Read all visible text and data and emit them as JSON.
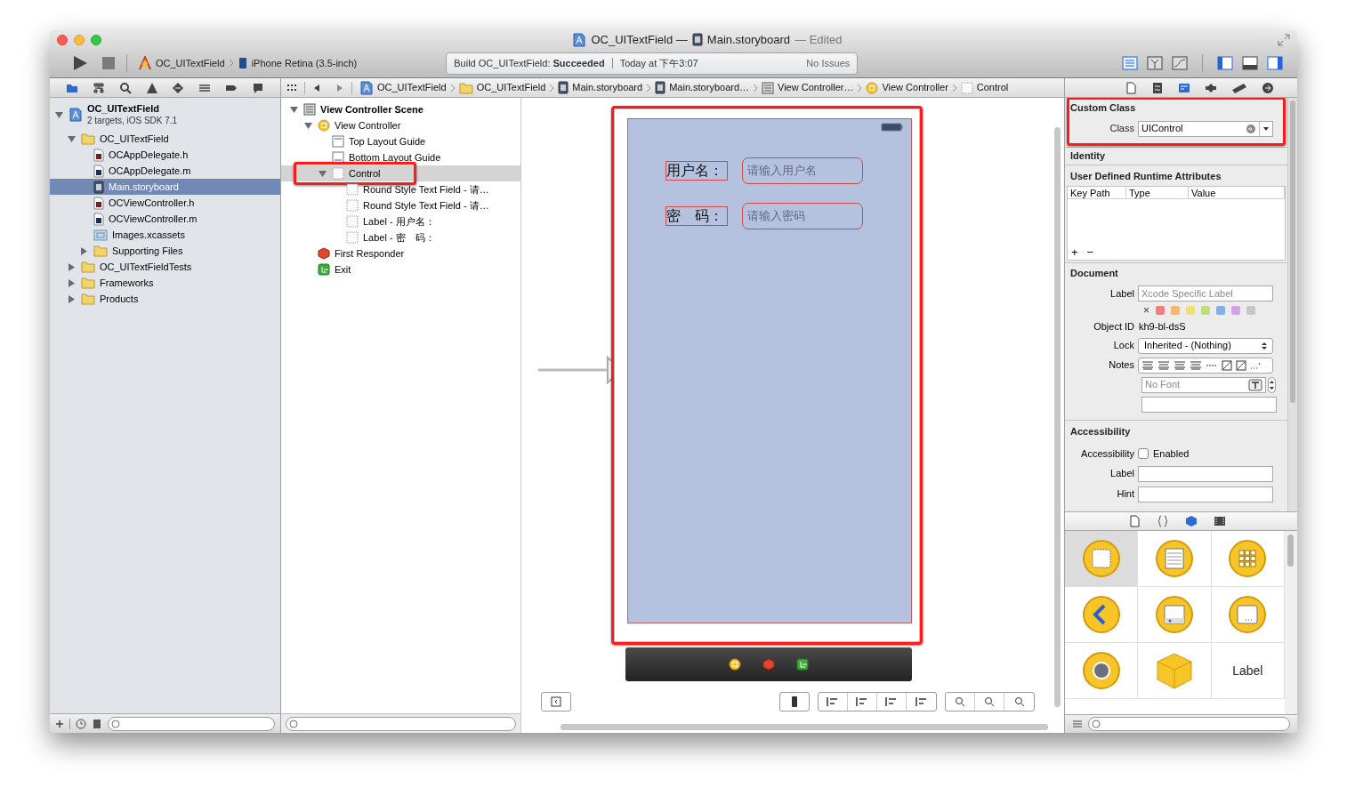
{
  "window": {
    "title_project": "OC_UITextField —",
    "title_file": "Main.storyboard",
    "title_state": "— Edited"
  },
  "toolbar": {
    "scheme": "OC_UITextField",
    "device": "iPhone Retina (3.5-inch)",
    "build": "Build OC_UITextField: **Succeeded**",
    "time": "Today at 下午3:07",
    "issues": "No Issues"
  },
  "jump_bar": [
    {
      "label": "OC_UITextField",
      "kind": "project"
    },
    {
      "label": "OC_UITextField",
      "kind": "folder"
    },
    {
      "label": "Main.storyboard",
      "kind": "storyboard"
    },
    {
      "label": "Main.storyboard…",
      "kind": "storyboard"
    },
    {
      "label": "View Controller…",
      "kind": "scene"
    },
    {
      "label": "View Controller",
      "kind": "vc"
    },
    {
      "label": "Control",
      "kind": "view"
    }
  ],
  "navigator": {
    "tree": [
      {
        "name": "OC_UITextField",
        "subtitle": "2 targets, iOS SDK 7.1",
        "kind": "project",
        "expanded": true,
        "selected": false,
        "children": [
          {
            "name": "OC_UITextField",
            "kind": "folder",
            "expanded": true,
            "selected": false,
            "children": [
              {
                "name": "OCAppDelegate.h",
                "kind": "h",
                "selected": false
              },
              {
                "name": "OCAppDelegate.m",
                "kind": "m",
                "selected": false
              },
              {
                "name": "Main.storyboard",
                "kind": "storyboard",
                "selected": true
              },
              {
                "name": "OCViewController.h",
                "kind": "h",
                "selected": false
              },
              {
                "name": "OCViewController.m",
                "kind": "m",
                "selected": false
              },
              {
                "name": "Images.xcassets",
                "kind": "assets",
                "selected": false
              },
              {
                "name": "Supporting Files",
                "kind": "folder",
                "expanded": false,
                "selected": false
              }
            ]
          },
          {
            "name": "OC_UITextFieldTests",
            "kind": "folder",
            "expanded": false,
            "selected": false
          },
          {
            "name": "Frameworks",
            "kind": "folder",
            "expanded": false,
            "selected": false
          },
          {
            "name": "Products",
            "kind": "folder",
            "expanded": false,
            "selected": false
          }
        ]
      }
    ]
  },
  "outline": {
    "tree": [
      {
        "name": "View Controller Scene",
        "kind": "scene",
        "expanded": true,
        "selected": false,
        "children": [
          {
            "name": "View Controller",
            "kind": "vc",
            "expanded": true,
            "selected": false,
            "children": [
              {
                "name": "Top Layout Guide",
                "kind": "guide_top",
                "selected": false
              },
              {
                "name": "Bottom Layout Guide",
                "kind": "guide_bottom",
                "selected": false
              },
              {
                "name": "Control",
                "kind": "view",
                "expanded": true,
                "selected": true,
                "annotated": true,
                "children": [
                  {
                    "name": "Round Style Text Field - 请…",
                    "kind": "view",
                    "selected": false
                  },
                  {
                    "name": "Round Style Text Field - 请…",
                    "kind": "view",
                    "selected": false
                  },
                  {
                    "name": "Label - 用户名：",
                    "kind": "view",
                    "selected": false
                  },
                  {
                    "name": "Label - 密　码：",
                    "kind": "view",
                    "selected": false
                  }
                ]
              }
            ]
          },
          {
            "name": "First Responder",
            "kind": "responder",
            "selected": false
          },
          {
            "name": "Exit",
            "kind": "exit",
            "selected": false
          }
        ]
      }
    ]
  },
  "canvas": {
    "annotated": true,
    "fields": [
      {
        "label": "用户名：",
        "placeholder": "请输入用户名"
      },
      {
        "label": "密　码：",
        "placeholder": "请输入密码"
      }
    ]
  },
  "inspector": {
    "custom_class": {
      "title": "Custom Class",
      "annotated": true,
      "class_label": "Class",
      "class_value": "UIControl"
    },
    "identity": {
      "title": "Identity"
    },
    "runtime": {
      "title": "User Defined Runtime Attributes",
      "columns": [
        "Key Path",
        "Type",
        "Value"
      ],
      "add": "+",
      "remove": "−"
    },
    "document": {
      "title": "Document",
      "label_label": "Label",
      "label_placeholder": "Xcode Specific Label",
      "clear": "×",
      "swatches": [
        {
          "color": "#ee7f7f"
        },
        {
          "color": "#f5b86e"
        },
        {
          "color": "#efe071"
        },
        {
          "color": "#bde07c"
        },
        {
          "color": "#7db2ee"
        },
        {
          "color": "#d4a3e6"
        },
        {
          "color": "#c6c6c6"
        }
      ],
      "object_id_label": "Object ID",
      "object_id": "kh9-bl-dsS",
      "lock_label": "Lock",
      "lock_value": "Inherited - (Nothing)",
      "notes_label": "Notes",
      "font_placeholder": "No Font"
    },
    "accessibility": {
      "title": "Accessibility",
      "enabled_label": "Accessibility",
      "enabled_text": "Enabled",
      "enabled": false,
      "label_label": "Label",
      "hint_label": "Hint"
    }
  },
  "library": {
    "items": [
      {
        "kind": "view",
        "selected": true
      },
      {
        "kind": "table",
        "selected": false
      },
      {
        "kind": "grid",
        "selected": false
      },
      {
        "kind": "back",
        "selected": false
      },
      {
        "kind": "tabbar",
        "selected": false
      },
      {
        "kind": "dialog",
        "selected": false
      },
      {
        "kind": "object",
        "selected": false
      },
      {
        "kind": "cube",
        "selected": false
      },
      {
        "kind": "label",
        "text": "Label",
        "selected": false
      }
    ]
  }
}
